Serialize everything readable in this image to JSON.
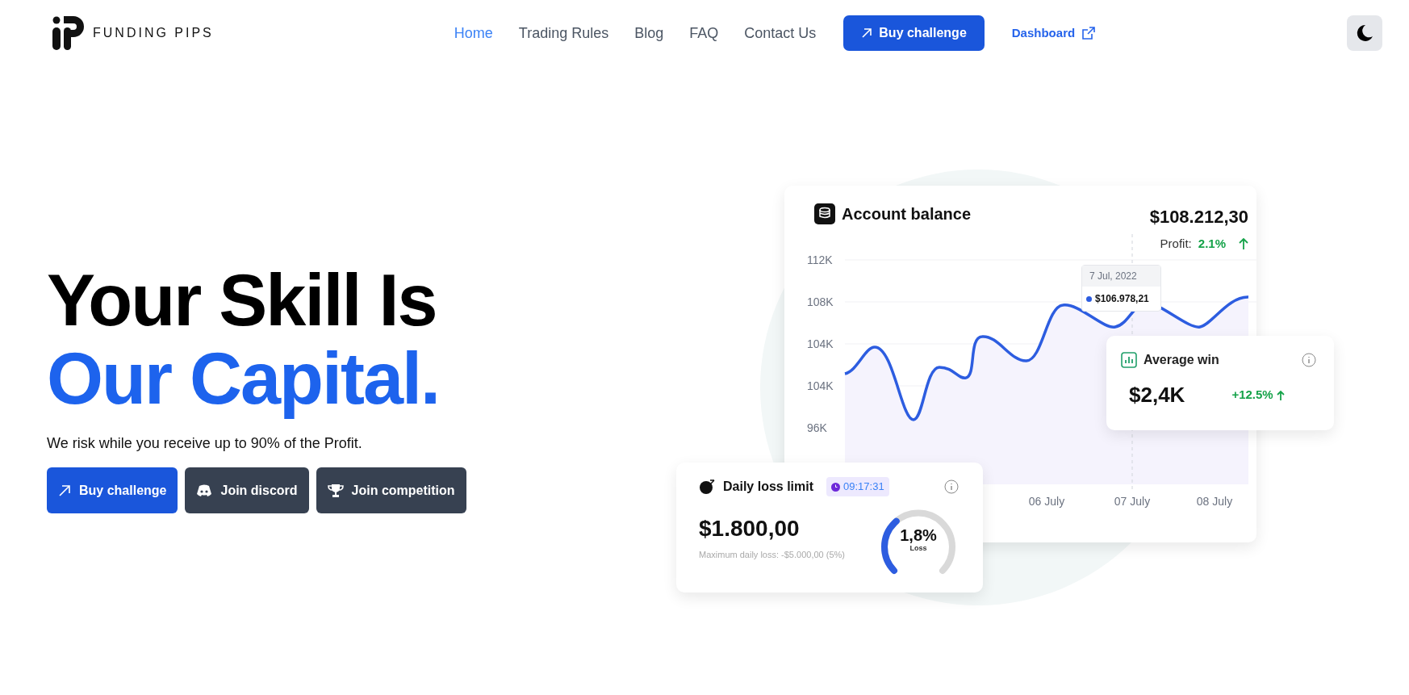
{
  "brand": {
    "name": "FUNDING PIPS"
  },
  "nav": {
    "links": [
      {
        "label": "Home",
        "selected": true
      },
      {
        "label": "Trading Rules",
        "selected": false
      },
      {
        "label": "Blog",
        "selected": false
      },
      {
        "label": "FAQ",
        "selected": false
      },
      {
        "label": "Contact Us",
        "selected": false
      }
    ],
    "cta": "Buy challenge",
    "dashboard": "Dashboard"
  },
  "hero": {
    "title_line_1": "Your Skill Is",
    "title_line_2": "Our Capital.",
    "subtitle": "We risk while you receive up to 90% of the Profit.",
    "buttons": [
      {
        "label": "Buy challenge",
        "kind": "primary"
      },
      {
        "label": "Join discord",
        "kind": "discord"
      },
      {
        "label": "Join competition",
        "kind": "trophy"
      }
    ]
  },
  "balance_card": {
    "title": "Account balance",
    "amount": "$108.212,30",
    "profit_label": "Profit:",
    "profit_value": "2.1%",
    "y_labels": [
      "112K",
      "108K",
      "104K",
      "104K",
      "96K"
    ],
    "x_labels": [
      "06 July",
      "07 July",
      "08 July"
    ],
    "tooltip": {
      "date": "7 Jul, 2022",
      "value": "$106.978,21"
    }
  },
  "average_win": {
    "title": "Average win",
    "amount": "$2,4K",
    "change": "+12.5%"
  },
  "daily_loss": {
    "title": "Daily loss limit",
    "timer": "09:17:31",
    "amount": "$1.800,00",
    "note": "Maximum daily loss: -$5.000,00 (5%)",
    "gauge": {
      "value": "1,8%",
      "label": "Loss"
    }
  }
}
